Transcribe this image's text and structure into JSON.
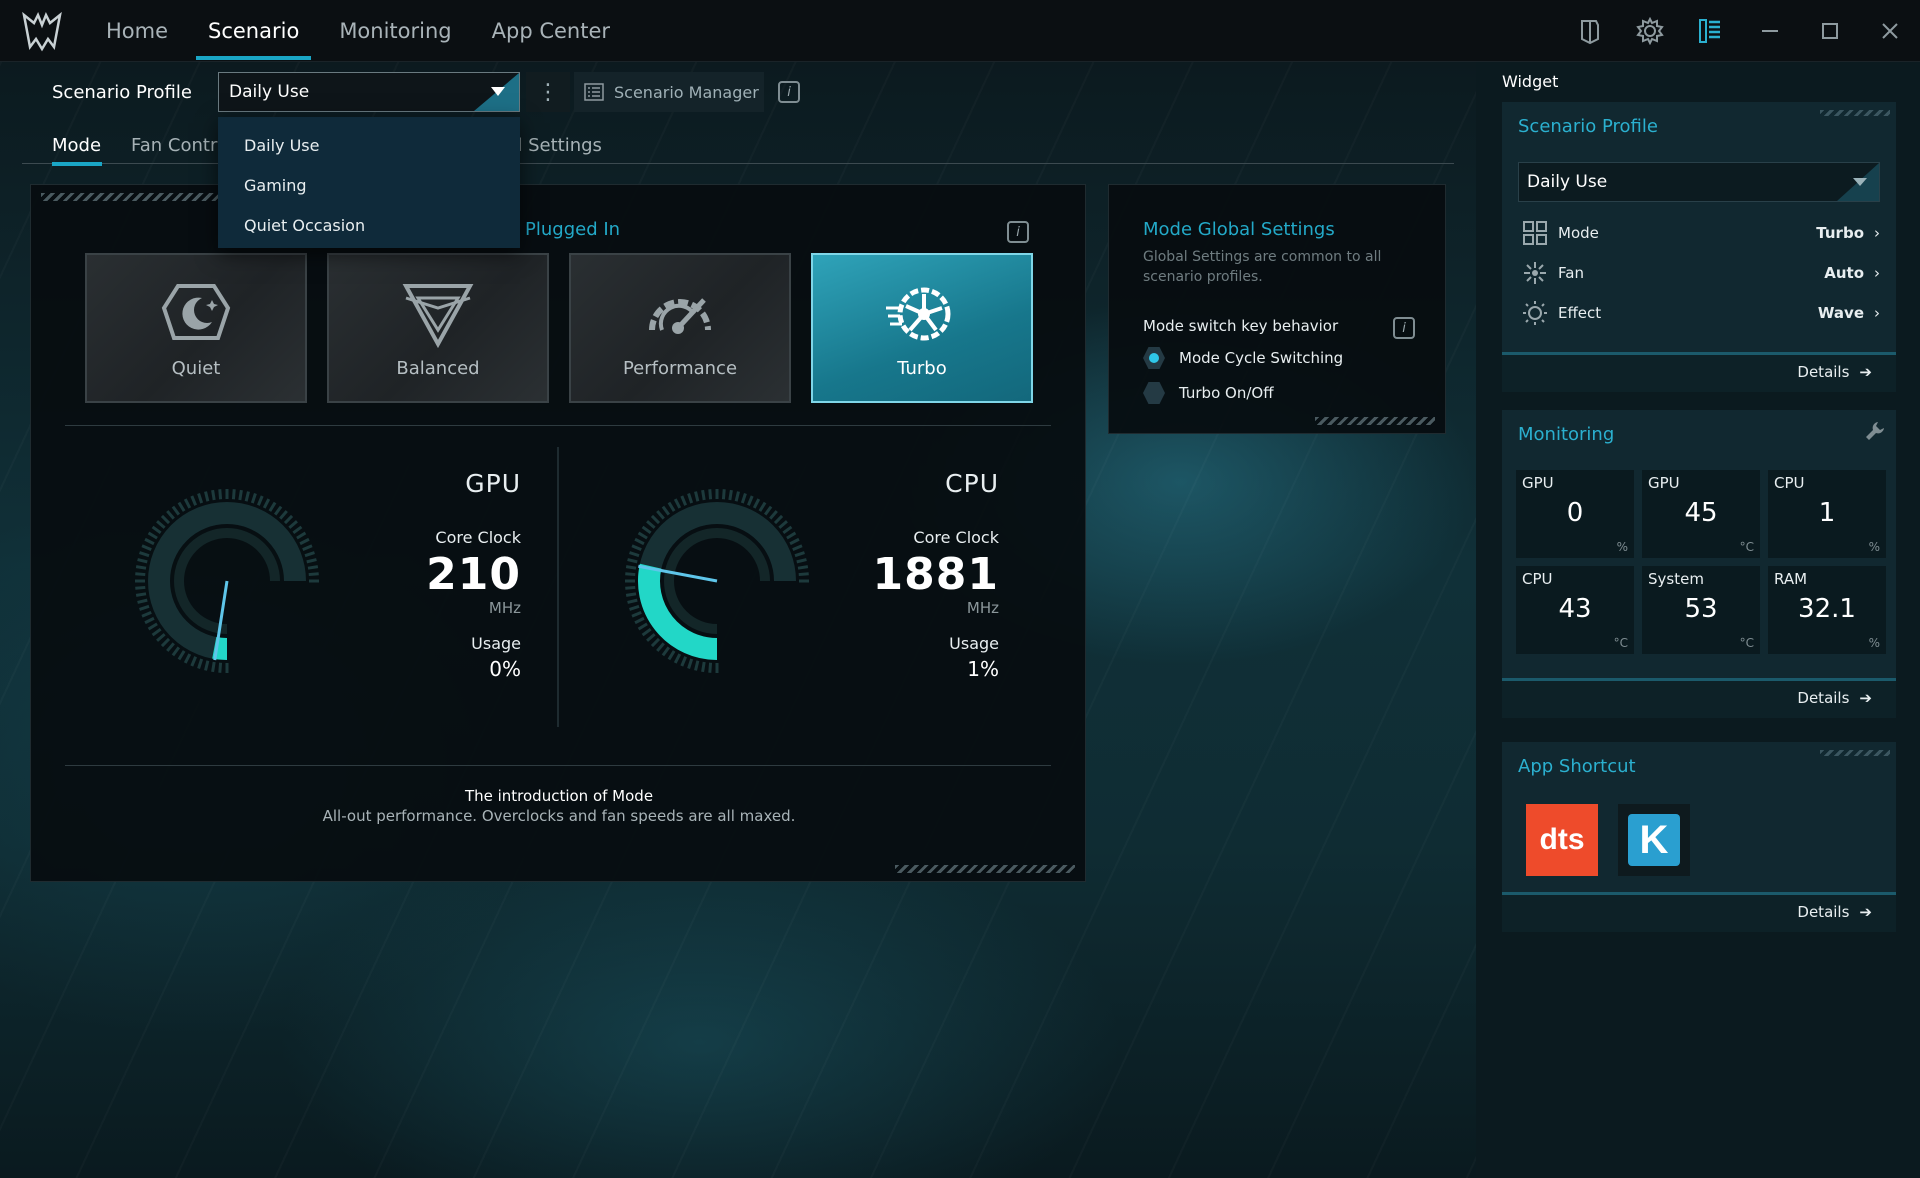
{
  "titlebar": {
    "tabs": [
      {
        "label": "Home",
        "active": false
      },
      {
        "label": "Scenario",
        "active": true
      },
      {
        "label": "Monitoring",
        "active": false
      },
      {
        "label": "App Center",
        "active": false
      }
    ],
    "icons": [
      "laptop-shield-icon",
      "gear-icon",
      "widget-panel-icon",
      "minimize-icon",
      "maximize-icon",
      "close-icon"
    ]
  },
  "scenario": {
    "profile_label": "Scenario Profile",
    "profile_value": "Daily Use",
    "manager_label": "Scenario Manager",
    "dropdown_options": [
      "Daily Use",
      "Gaming",
      "Quiet Occasion"
    ]
  },
  "subtabs": [
    {
      "label": "Mode",
      "active": true
    },
    {
      "label": "Fan Contr",
      "active": false
    },
    {
      "label": "l Settings",
      "active": false
    }
  ],
  "mode": {
    "power_state": "Plugged In",
    "cards": [
      {
        "label": "Quiet",
        "icon": "quiet-moon-icon",
        "active": false
      },
      {
        "label": "Balanced",
        "icon": "balanced-icon",
        "active": false
      },
      {
        "label": "Performance",
        "icon": "performance-gauge-icon",
        "active": false
      },
      {
        "label": "Turbo",
        "icon": "turbo-fan-icon",
        "active": true
      }
    ],
    "gpu": {
      "title": "GPU",
      "clock_label": "Core Clock",
      "clock": "210",
      "clock_unit": "MHz",
      "usage_label": "Usage",
      "usage": "0%",
      "usage_fraction": 0.02
    },
    "cpu": {
      "title": "CPU",
      "clock_label": "Core Clock",
      "clock": "1881",
      "clock_unit": "MHz",
      "usage_label": "Usage",
      "usage": "1%",
      "usage_fraction": 0.38
    },
    "intro_title": "The introduction of Mode",
    "intro_text": "All-out performance. Overclocks and fan speeds are all maxed."
  },
  "global_settings": {
    "title": "Mode Global Settings",
    "subtitle": "Global Settings are common to all scenario profiles.",
    "key_label": "Mode switch key behavior",
    "options": [
      {
        "label": "Mode Cycle Switching",
        "selected": true
      },
      {
        "label": "Turbo On/Off",
        "selected": false
      }
    ]
  },
  "widget": {
    "heading": "Widget",
    "profile_card": {
      "title": "Scenario Profile",
      "select_value": "Daily Use",
      "rows": [
        {
          "label": "Mode",
          "value": "Turbo",
          "icon": "grid-icon"
        },
        {
          "label": "Fan",
          "value": "Auto",
          "icon": "fan-icon"
        },
        {
          "label": "Effect",
          "value": "Wave",
          "icon": "sun-effect-icon"
        }
      ],
      "details": "Details"
    },
    "monitoring_card": {
      "title": "Monitoring",
      "cells": [
        {
          "label": "GPU",
          "value": "0",
          "unit": "%"
        },
        {
          "label": "GPU",
          "value": "45",
          "unit": "°C"
        },
        {
          "label": "CPU",
          "value": "1",
          "unit": "%"
        },
        {
          "label": "CPU",
          "value": "43",
          "unit": "°C"
        },
        {
          "label": "System",
          "value": "53",
          "unit": "°C"
        },
        {
          "label": "RAM",
          "value": "32.1",
          "unit": "%"
        }
      ],
      "details": "Details"
    },
    "shortcut_card": {
      "title": "App Shortcut",
      "apps": [
        {
          "label": "dts",
          "icon": "dts-icon"
        },
        {
          "label": "K",
          "icon": "killer-icon"
        }
      ],
      "details": "Details"
    }
  },
  "colors": {
    "accent": "#1aa6c6",
    "turbo": "#1f8aa2",
    "gauge": "#22d7c7"
  }
}
